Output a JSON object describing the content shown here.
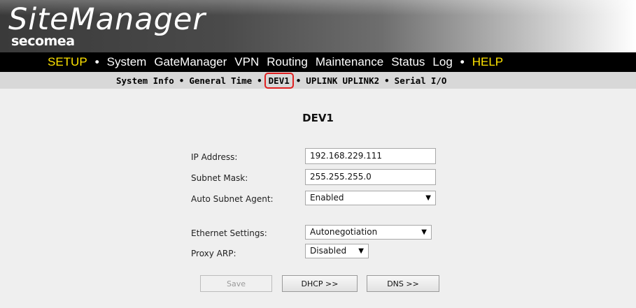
{
  "header": {
    "app_title": "SiteManager",
    "brand": "secomea"
  },
  "main_nav": {
    "items": [
      {
        "label": "SETUP",
        "color": "#ffe300"
      },
      {
        "label": "System"
      },
      {
        "label": "GateManager"
      },
      {
        "label": "VPN"
      },
      {
        "label": "Routing"
      },
      {
        "label": "Maintenance"
      },
      {
        "label": "Status"
      },
      {
        "label": "Log"
      },
      {
        "label": "HELP",
        "color": "#ffe300"
      }
    ],
    "separator": "•"
  },
  "sub_nav": {
    "items": [
      {
        "label": "System Info"
      },
      {
        "label": "General"
      },
      {
        "label": "Time"
      },
      {
        "label": "DEV1",
        "active": true
      },
      {
        "label": "UPLINK"
      },
      {
        "label": "UPLINK2"
      },
      {
        "label": "Serial"
      },
      {
        "label": "I/O"
      }
    ],
    "separator": "•",
    "active_outline_color": "#e02020"
  },
  "page": {
    "title": "DEV1",
    "fields": {
      "ip_address": {
        "label": "IP Address:",
        "value": "192.168.229.111"
      },
      "subnet_mask": {
        "label": "Subnet Mask:",
        "value": "255.255.255.0"
      },
      "auto_subnet_agent": {
        "label": "Auto Subnet Agent:",
        "value": "Enabled"
      },
      "ethernet_settings": {
        "label": "Ethernet Settings:",
        "value": "Autonegotiation"
      },
      "proxy_arp": {
        "label": "Proxy ARP:",
        "value": "Disabled"
      }
    },
    "buttons": {
      "save": "Save",
      "dhcp": "DHCP >>",
      "dns": "DNS >>"
    }
  }
}
